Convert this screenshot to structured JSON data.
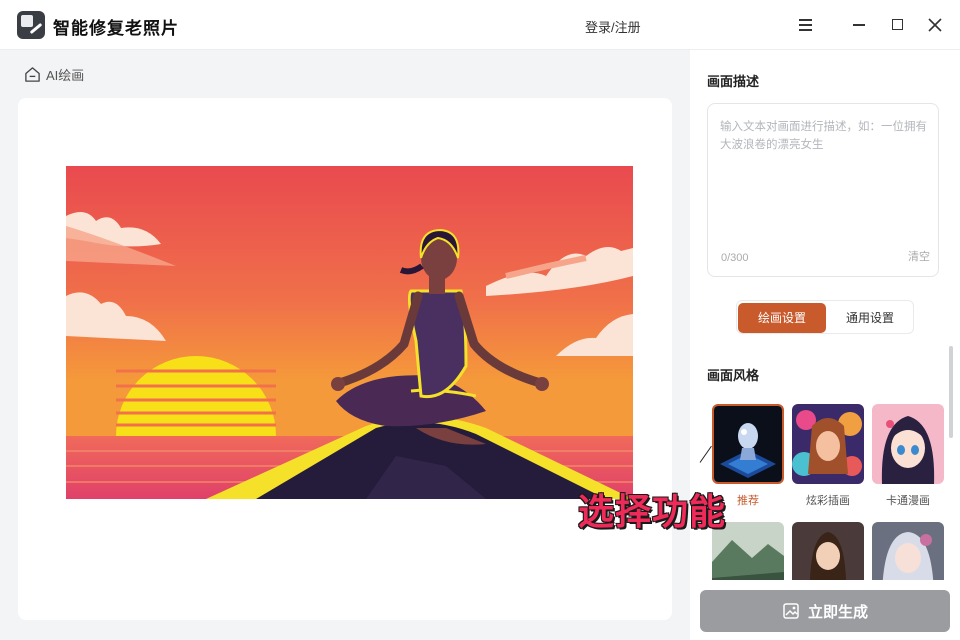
{
  "app": {
    "title": "智能修复老照片",
    "login_label": "登录/注册"
  },
  "breadcrumb": {
    "label": "AI绘画"
  },
  "panel": {
    "description_title": "画面描述",
    "description_placeholder": "输入文本对画面进行描述，如：一位拥有大波浪卷的漂亮女生",
    "char_count": "0/300",
    "clear_label": "清空",
    "tabs": [
      {
        "label": "绘画设置",
        "active": true
      },
      {
        "label": "通用设置",
        "active": false
      }
    ],
    "style_title": "画面风格",
    "styles": [
      {
        "label": "推荐",
        "selected": true,
        "thumb": "crystal-chess"
      },
      {
        "label": "炫彩插画",
        "selected": false,
        "thumb": "colorful-portrait"
      },
      {
        "label": "卡通漫画",
        "selected": false,
        "thumb": "anime-girl"
      },
      {
        "label": "",
        "selected": false,
        "thumb": "landscape"
      },
      {
        "label": "",
        "selected": false,
        "thumb": "fantasy-girl"
      },
      {
        "label": "",
        "selected": false,
        "thumb": "silver-hair"
      }
    ],
    "generate_label": "立即生成"
  },
  "annotation": {
    "text": "选择功能"
  },
  "colors": {
    "accent": "#c85a2c",
    "annotation": "#ef2a58",
    "generate_disabled": "#9a9c9f"
  }
}
